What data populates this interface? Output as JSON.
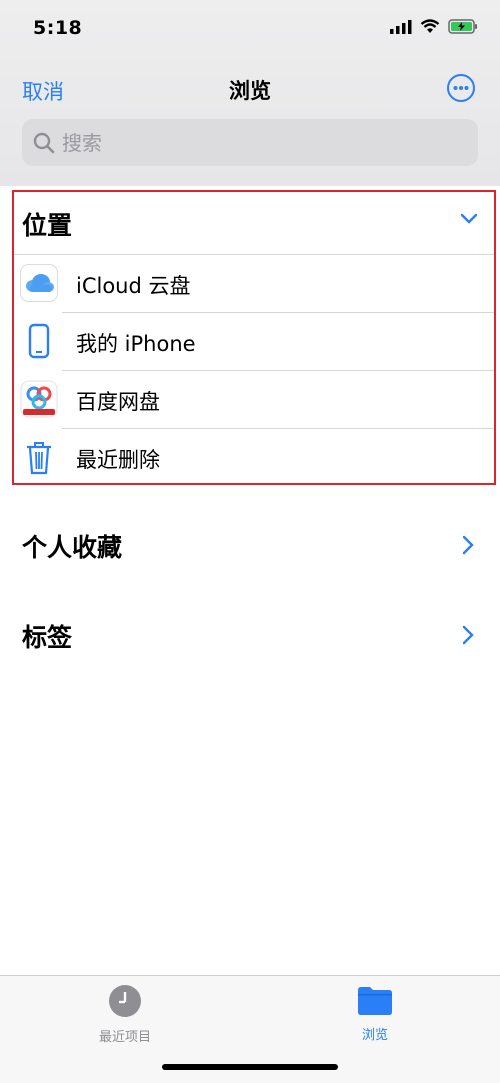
{
  "status": {
    "time": "5:18"
  },
  "nav": {
    "cancel": "取消",
    "title": "浏览",
    "more": "more"
  },
  "search": {
    "placeholder": "搜索"
  },
  "locations": {
    "header": "位置",
    "items": [
      {
        "label": "iCloud 云盘",
        "icon": "icloud-icon"
      },
      {
        "label": "我的 iPhone",
        "icon": "iphone-icon"
      },
      {
        "label": "百度网盘",
        "icon": "baidu-netdisk-icon"
      },
      {
        "label": "最近删除",
        "icon": "trash-icon"
      }
    ]
  },
  "favorites": {
    "label": "个人收藏"
  },
  "tags": {
    "label": "标签"
  },
  "tabbar": {
    "tabs": [
      {
        "label": "最近项目",
        "icon": "clock-icon",
        "selected": false
      },
      {
        "label": "浏览",
        "icon": "folder-icon",
        "selected": true
      }
    ]
  },
  "colors": {
    "accent": "#2a7ff6",
    "highlight_border": "#d9252b"
  }
}
